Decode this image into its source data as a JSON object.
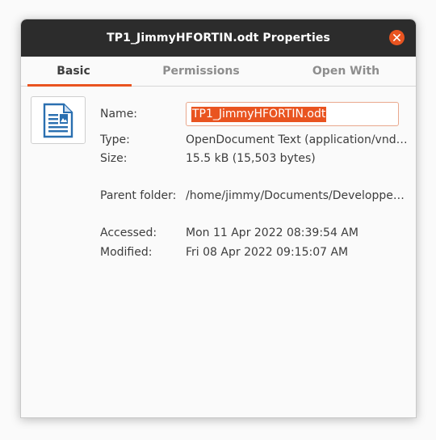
{
  "window": {
    "title": "TP1_JimmyHFORTIN.odt Properties"
  },
  "tabs": [
    {
      "label": "Basic",
      "active": true
    },
    {
      "label": "Permissions",
      "active": false
    },
    {
      "label": "Open With",
      "active": false
    }
  ],
  "file_icon": "document-text-icon",
  "fields": {
    "name_label": "Name:",
    "name_value": "TP1_JimmyHFORTIN.odt",
    "type_label": "Type:",
    "type_value": "OpenDocument Text (application/vnd…",
    "size_label": "Size:",
    "size_value": "15.5 kB (15,503 bytes)",
    "parent_label": "Parent folder:",
    "parent_value": "/home/jimmy/Documents/Developpe…",
    "accessed_label": "Accessed:",
    "accessed_value": "Mon 11 Apr 2022 08:39:54 AM",
    "modified_label": "Modified:",
    "modified_value": "Fri 08 Apr 2022 09:15:07 AM"
  },
  "colors": {
    "accent": "#e95420",
    "titlebar": "#2c2c2c"
  }
}
